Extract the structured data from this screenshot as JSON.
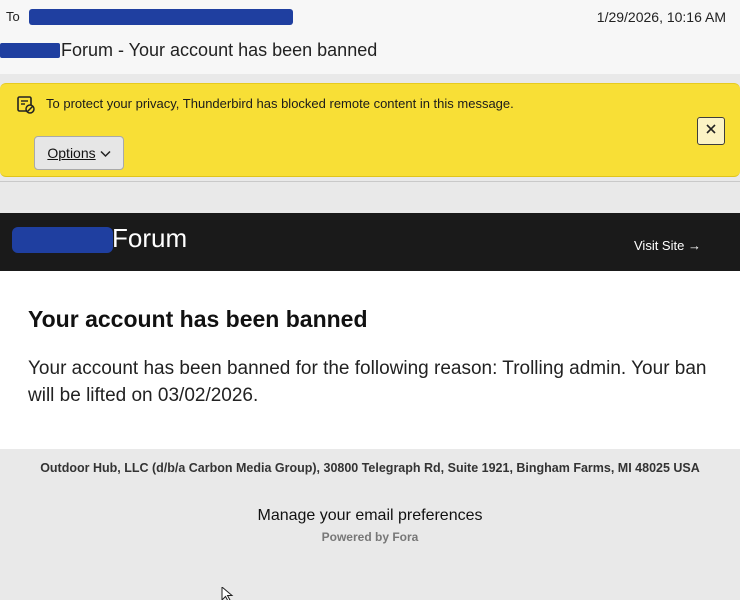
{
  "header": {
    "to_label": "To",
    "date": "1/29/2026, 10:16 AM",
    "subject": "Forum - Your account has been banned"
  },
  "notification": {
    "icon": "remote-content-blocked-icon",
    "text": "To protect your privacy, Thunderbird has blocked remote content in this message.",
    "options_label": "Options",
    "options_icon": "chevron-down-icon",
    "close_icon": "close-icon"
  },
  "email": {
    "forum_name": "Forum",
    "visit_site": "Visit Site →",
    "title": "Your account has been banned",
    "reason": "Your account has been banned for the following reason: Trolling admin. Your ban will be lifted on 03/02/2026."
  },
  "footer": {
    "address": "Outdoor Hub, LLC (d/b/a Carbon Media Group), 30800 Telegraph Rd, Suite 1921, Bingham Farms, MI 48025 USA",
    "manage_prefs": "Manage your email preferences",
    "powered_by": "Powered by Fora"
  },
  "colors": {
    "notification_bg": "#f8df36",
    "forum_bar_bg": "#1a1a1a",
    "redaction": "#1f3fa0"
  }
}
